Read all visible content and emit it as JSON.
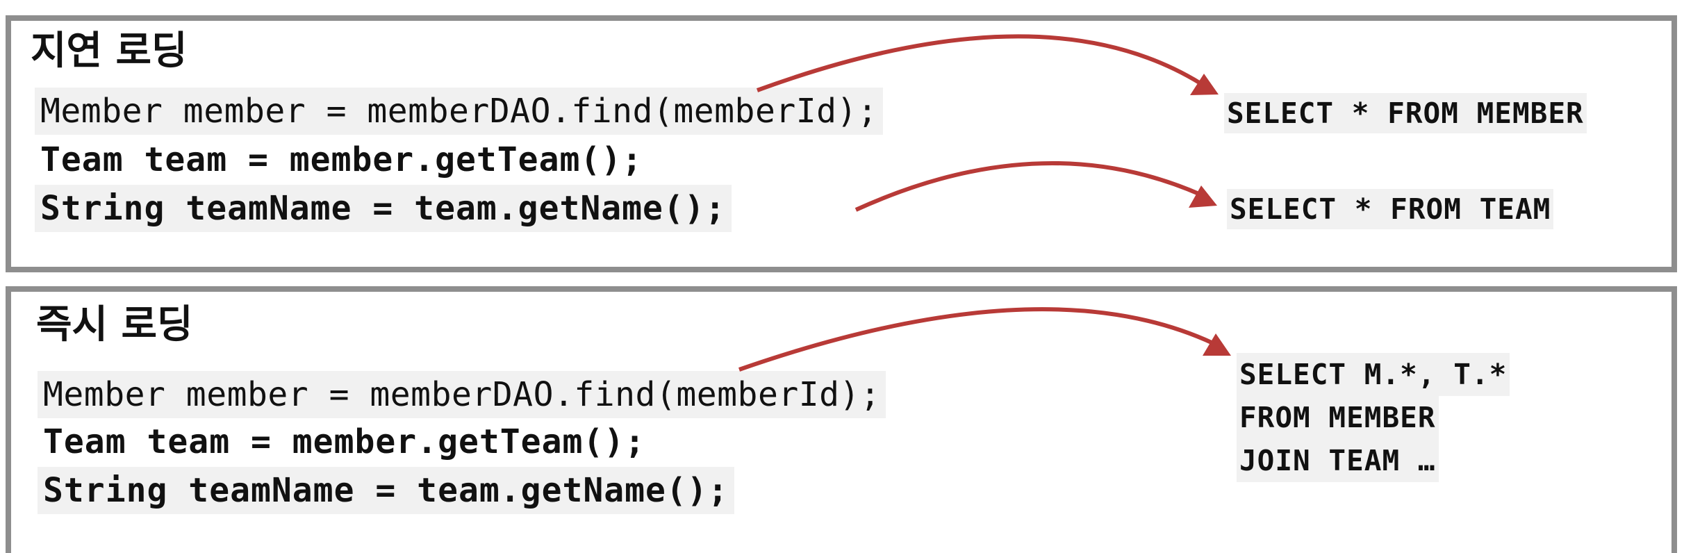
{
  "lazy": {
    "heading": "지연 로딩",
    "code": [
      "Member member = memberDAO.find(memberId);",
      "Team team = member.getTeam();",
      "String teamName = team.getName();"
    ],
    "sql": [
      "SELECT * FROM MEMBER",
      "SELECT * FROM TEAM"
    ]
  },
  "eager": {
    "heading": "즉시 로딩",
    "code": [
      "Member member = memberDAO.find(memberId);",
      "Team team = member.getTeam();",
      "String teamName = team.getName();"
    ],
    "sql": [
      "SELECT M.*, T.*",
      "FROM MEMBER",
      "JOIN TEAM …"
    ]
  },
  "colors": {
    "arrow": "#b83a37",
    "border": "#8e8e8e",
    "code_bg": "#f1f1f1"
  }
}
